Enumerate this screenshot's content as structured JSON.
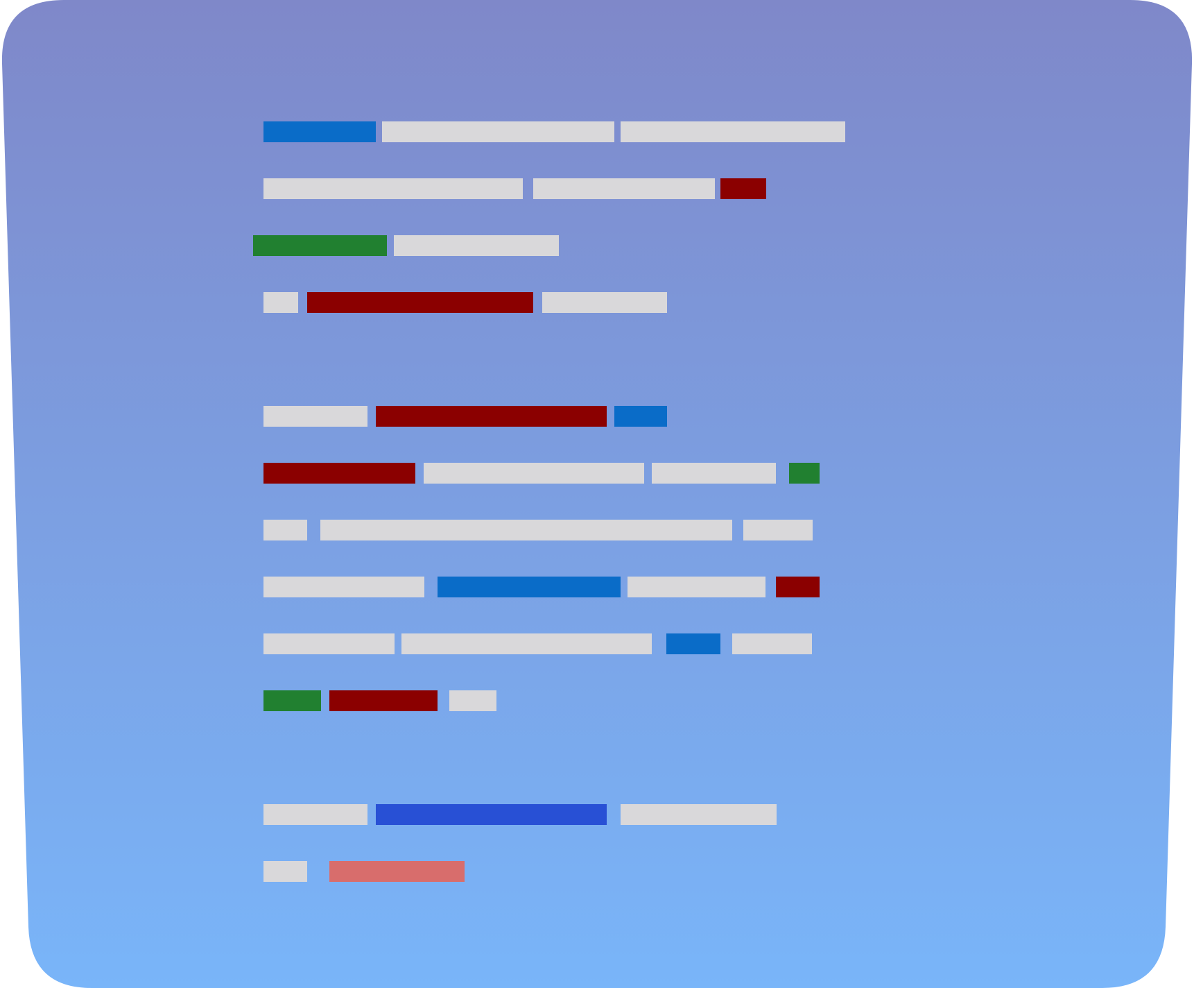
{
  "illustration": {
    "subject": "code-lines-illustration",
    "background": {
      "gradient_top": "#7F88C9",
      "gradient_bottom": "#79B5F9"
    },
    "palette": {
      "plain": "#D9D8DA",
      "keyword": "#0A6CC8",
      "string": "#8B0000",
      "comment": "#218030",
      "highlight": "#2850D5",
      "soft": "#D86D6C"
    },
    "lines": [
      {
        "tokens": [
          "keyword",
          "plain",
          "plain"
        ]
      },
      {
        "tokens": [
          "plain",
          "plain",
          "string"
        ]
      },
      {
        "tokens": [
          "comment",
          "plain"
        ]
      },
      {
        "tokens": [
          "plain",
          "string",
          "plain"
        ]
      },
      {
        "tokens": []
      },
      {
        "tokens": [
          "plain",
          "string",
          "keyword"
        ]
      },
      {
        "tokens": [
          "string",
          "plain",
          "plain",
          "comment"
        ]
      },
      {
        "tokens": [
          "plain",
          "plain",
          "plain"
        ]
      },
      {
        "tokens": [
          "plain",
          "keyword",
          "plain",
          "string"
        ]
      },
      {
        "tokens": [
          "plain",
          "plain",
          "keyword",
          "plain"
        ]
      },
      {
        "tokens": [
          "comment",
          "string",
          "plain"
        ]
      },
      {
        "tokens": []
      },
      {
        "tokens": [
          "plain",
          "highlight",
          "plain"
        ]
      },
      {
        "tokens": [
          "plain",
          "soft"
        ]
      }
    ]
  }
}
